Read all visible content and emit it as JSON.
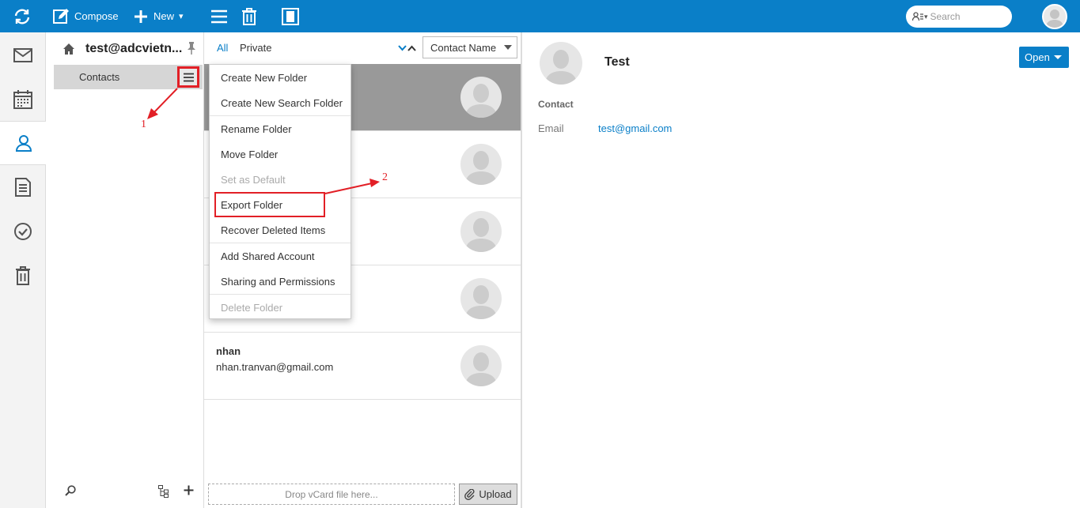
{
  "topbar": {
    "compose_label": "Compose",
    "new_label": "New",
    "new_caret": "▾",
    "search_placeholder": "Search",
    "search_caret": "▾"
  },
  "folders": {
    "account_name": "test@adcvietn...",
    "items": [
      {
        "label": "Contacts"
      }
    ]
  },
  "list": {
    "filters": [
      "All",
      "Private"
    ],
    "sort_by": "Contact Name",
    "contacts": [
      {
        "name": "",
        "email": ""
      },
      {
        "name": "",
        "email": ""
      },
      {
        "name": "",
        "email": ""
      },
      {
        "name": "",
        "email": ""
      },
      {
        "name": "nhan",
        "email": "nhan.tranvan@gmail.com"
      }
    ],
    "dropzone_text": "Drop vCard file here...",
    "upload_label": "Upload"
  },
  "context_menu": {
    "items": [
      {
        "label": "Create New Folder",
        "disabled": false
      },
      {
        "label": "Create New Search Folder",
        "disabled": false
      },
      {
        "label": "Rename Folder",
        "disabled": false
      },
      {
        "label": "Move Folder",
        "disabled": false
      },
      {
        "label": "Set as Default",
        "disabled": true
      },
      {
        "label": "Export Folder",
        "disabled": false
      },
      {
        "label": "Recover Deleted Items",
        "disabled": false
      },
      {
        "label": "Add Shared Account",
        "disabled": false
      },
      {
        "label": "Sharing and Permissions",
        "disabled": false
      },
      {
        "label": "Delete Folder",
        "disabled": true
      }
    ]
  },
  "detail": {
    "name": "Test",
    "open_label": "Open",
    "section_label": "Contact",
    "email_label": "Email",
    "email_value": "test@gmail.com"
  },
  "annotations": {
    "step1": "1",
    "step2": "2"
  },
  "colors": {
    "accent": "#0a7fc8",
    "highlight": "#e21f26",
    "selected_row": "#999999"
  }
}
